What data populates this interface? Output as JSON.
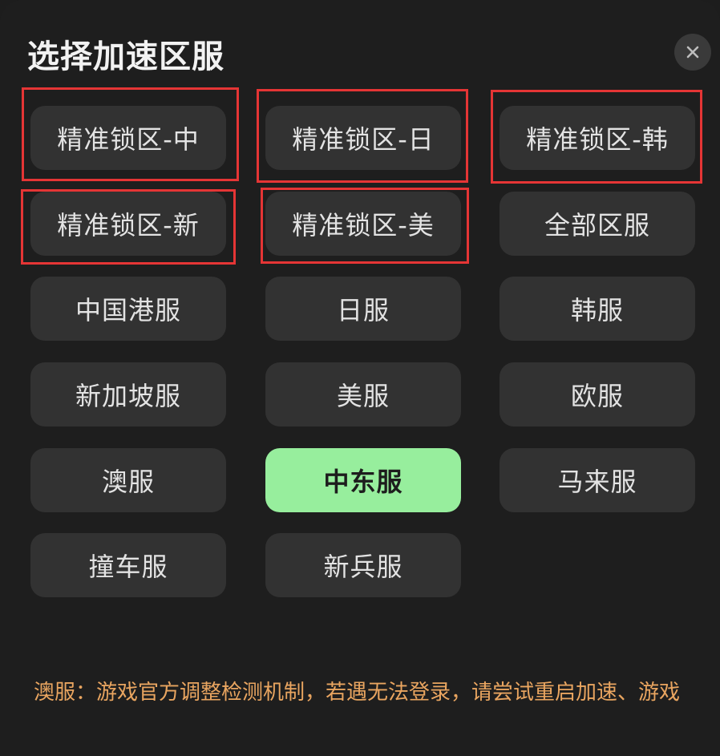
{
  "dialog": {
    "title": "选择加速区服",
    "close_icon": "close-icon"
  },
  "regions": [
    {
      "label": "精准锁区-中",
      "selected": false,
      "highlighted": true
    },
    {
      "label": "精准锁区-日",
      "selected": false,
      "highlighted": true
    },
    {
      "label": "精准锁区-韩",
      "selected": false,
      "highlighted": true
    },
    {
      "label": "精准锁区-新",
      "selected": false,
      "highlighted": true
    },
    {
      "label": "精准锁区-美",
      "selected": false,
      "highlighted": true
    },
    {
      "label": "全部区服",
      "selected": false,
      "highlighted": false
    },
    {
      "label": "中国港服",
      "selected": false,
      "highlighted": false
    },
    {
      "label": "日服",
      "selected": false,
      "highlighted": false
    },
    {
      "label": "韩服",
      "selected": false,
      "highlighted": false
    },
    {
      "label": "新加坡服",
      "selected": false,
      "highlighted": false
    },
    {
      "label": "美服",
      "selected": false,
      "highlighted": false
    },
    {
      "label": "欧服",
      "selected": false,
      "highlighted": false
    },
    {
      "label": "澳服",
      "selected": false,
      "highlighted": false
    },
    {
      "label": "中东服",
      "selected": true,
      "highlighted": false
    },
    {
      "label": "马来服",
      "selected": false,
      "highlighted": false
    },
    {
      "label": "撞车服",
      "selected": false,
      "highlighted": false
    },
    {
      "label": "新兵服",
      "selected": false,
      "highlighted": false
    }
  ],
  "note": {
    "text": "澳服：游戏官方调整检测机制，若遇无法登录，请尝试重启加速、游戏"
  },
  "colors": {
    "background": "#1e1e1e",
    "button": "#323232",
    "selected": "#97ee9d",
    "highlight_border": "#e53535",
    "note": "#e9a560"
  }
}
